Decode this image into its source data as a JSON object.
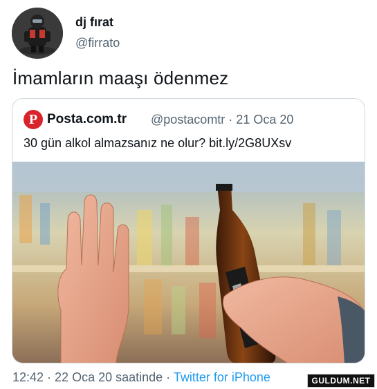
{
  "author": {
    "display_name": "dj fırat",
    "handle": "@firrato",
    "avatar_icon": "avatar-motorcyclist-icon"
  },
  "tweet": {
    "text": "İmamların maaşı ödenmez"
  },
  "quote": {
    "logo_letter": "P",
    "logo_color": "#d8232a",
    "name": "Posta.com.tr",
    "meta": "@postacomtr · 21 Oca 20",
    "text": "30 gün alkol almazsanız ne olur? bit.ly/2G8UXsv"
  },
  "footer": {
    "time": "12:42 · 22 Oca 20 saatinde · ",
    "source": "Twitter for iPhone"
  },
  "watermark": {
    "text": "GULDUM.NET"
  },
  "colors": {
    "text": "#0f1419",
    "secondary": "#536471",
    "link": "#1d9bf0",
    "border": "#cfd9de"
  }
}
